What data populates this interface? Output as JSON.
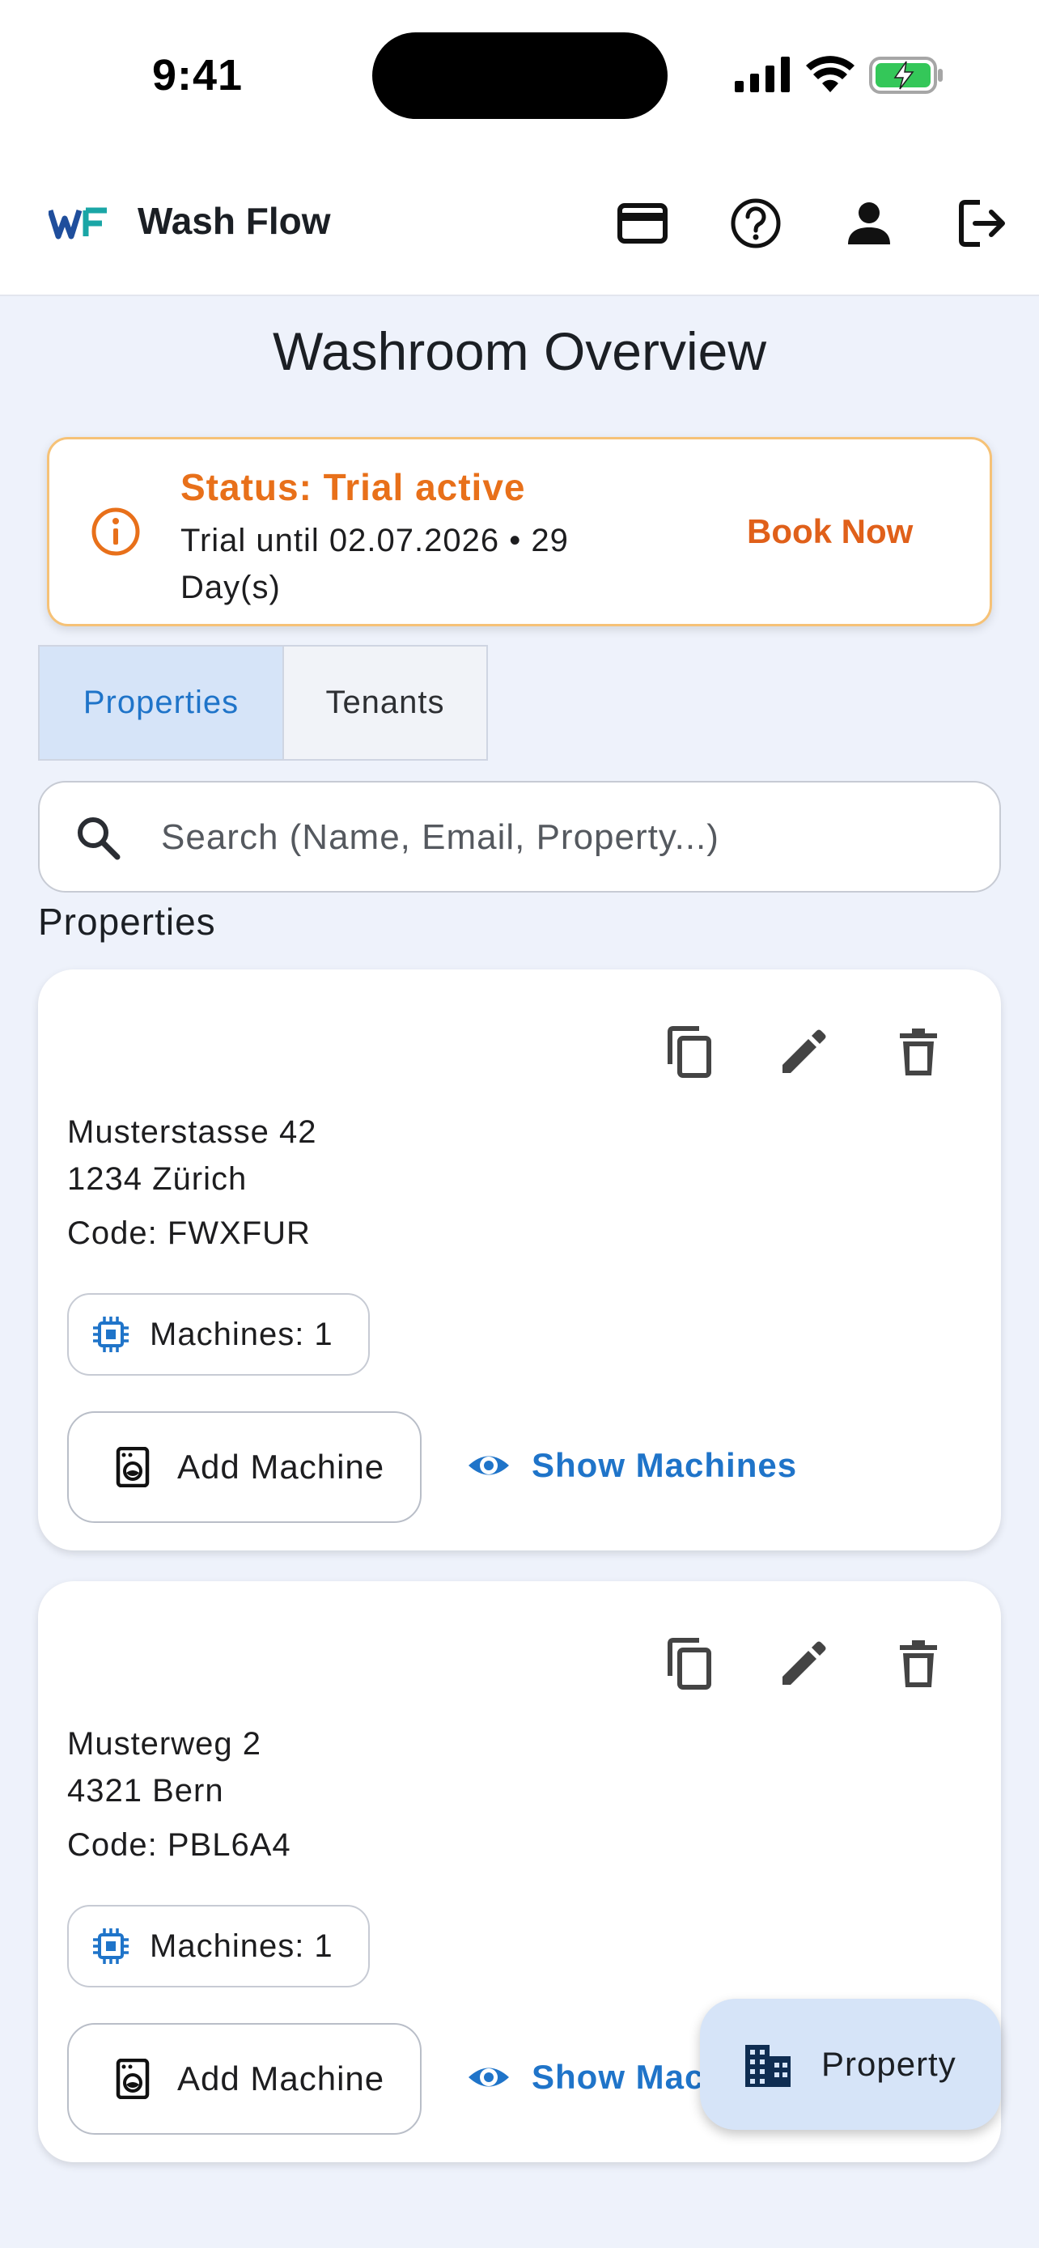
{
  "status_bar": {
    "time": "9:41"
  },
  "header": {
    "app_name": "Wash Flow",
    "logo_text": "WF"
  },
  "page": {
    "title": "Washroom Overview"
  },
  "trial_banner": {
    "title": "Status: Trial active",
    "text": "Trial until 02.07.2026 • 29 Day(s)",
    "action": "Book Now",
    "accent_color": "#e8701a"
  },
  "tabs": [
    {
      "label": "Properties",
      "active": true
    },
    {
      "label": "Tenants",
      "active": false
    }
  ],
  "search": {
    "placeholder": "Search (Name, Email, Property...)",
    "value": ""
  },
  "section": {
    "title": "Properties"
  },
  "properties": [
    {
      "street": "Musterstasse 42",
      "city": "1234 Zürich",
      "code": "Code: FWXFUR",
      "machines": "Machines: 1",
      "add_label": "Add Machine",
      "show_label": "Show Machines"
    },
    {
      "street": "Musterweg 2",
      "city": "4321 Bern",
      "code": "Code: PBL6A4",
      "machines": "Machines: 1",
      "add_label": "Add Machine",
      "show_label": "Show Machines"
    }
  ],
  "fab": {
    "label": "Property"
  },
  "colors": {
    "primary": "#1f74c9",
    "background": "#eef2fb",
    "tab_active_bg": "#d6e4f8"
  }
}
